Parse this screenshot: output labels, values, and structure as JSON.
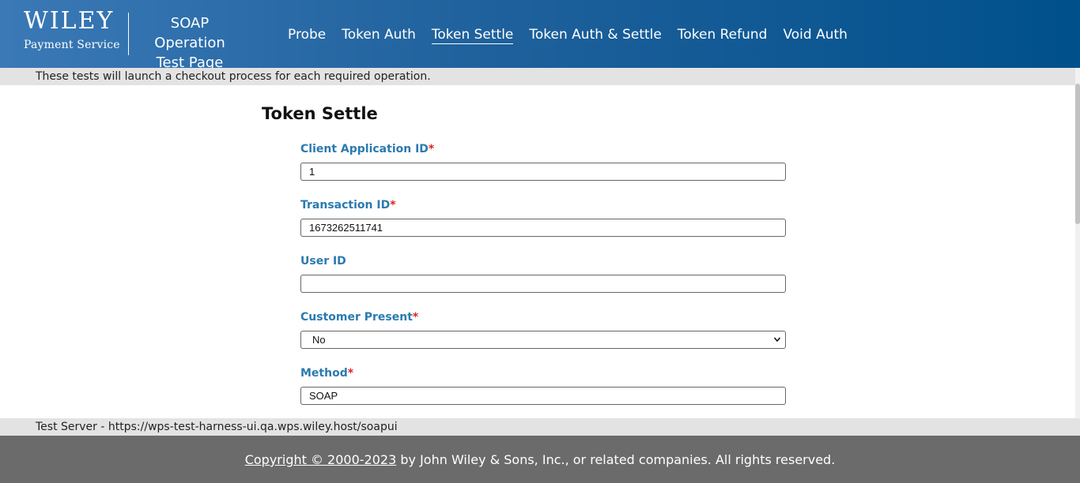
{
  "header": {
    "logo_word": "WILEY",
    "logo_sub": "Payment Service",
    "app_title_line1": "SOAP Operation",
    "app_title_line2": "Test Page",
    "nav": [
      {
        "label": "Probe",
        "active": false
      },
      {
        "label": "Token Auth",
        "active": false
      },
      {
        "label": "Token Settle",
        "active": true
      },
      {
        "label": "Token Auth & Settle",
        "active": false
      },
      {
        "label": "Token Refund",
        "active": false
      },
      {
        "label": "Void Auth",
        "active": false
      }
    ]
  },
  "info_text": "These tests will launch a checkout process for each required operation.",
  "form": {
    "title": "Token Settle",
    "fields": [
      {
        "label": "Client Application ID",
        "required": true,
        "value": "1"
      },
      {
        "label": "Transaction ID",
        "required": true,
        "value": "1673262511741"
      },
      {
        "label": "User ID",
        "required": false,
        "value": ""
      },
      {
        "label": "Customer Present",
        "required": true,
        "value": "No"
      },
      {
        "label": "Method",
        "required": true,
        "value": "SOAP"
      }
    ],
    "required_marker": "*"
  },
  "server_text": "Test Server - https://wps-test-harness-ui.qa.wps.wiley.host/soapui",
  "footer": {
    "copyright_link": "Copyright © 2000-2023",
    "rest": " by John Wiley & Sons, Inc., or related companies. All rights reserved."
  },
  "colors": {
    "header_start": "#3a79b6",
    "header_end": "#00508c",
    "label": "#2a7ab0",
    "required": "#e02020",
    "footer_bg": "#6b6b6b",
    "bar_bg": "#e3e3e3"
  },
  "icons": {
    "select_arrow": "chevron-down-icon"
  }
}
